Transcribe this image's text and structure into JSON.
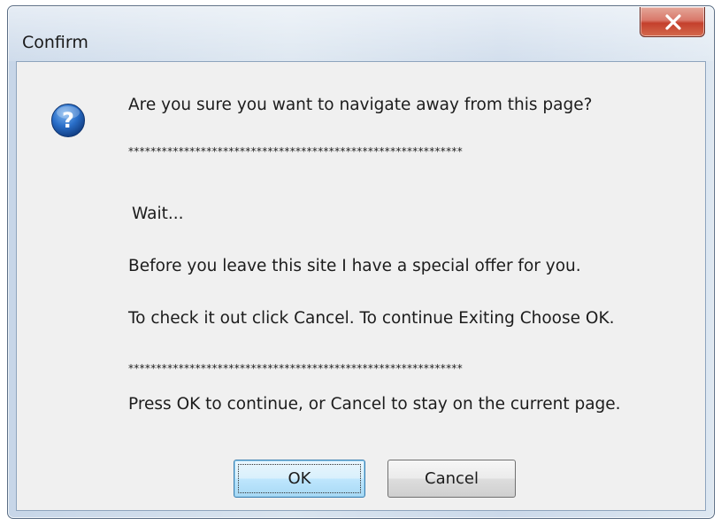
{
  "window": {
    "title": "Confirm"
  },
  "icons": {
    "question": "question-icon",
    "close": "close-icon"
  },
  "message": {
    "line1": "Are you sure you want to navigate away from this page?",
    "stars1": "************************************************************",
    "line2": "Wait...",
    "line3": "Before you leave this site I have a special offer for you.",
    "line4": "To check it out click Cancel. To continue Exiting Choose OK.",
    "stars2": "************************************************************",
    "line5": "Press OK to continue, or Cancel to stay on the current page."
  },
  "buttons": {
    "ok_label": "OK",
    "cancel_label": "Cancel"
  },
  "colors": {
    "close_button": "#c4402c",
    "icon_blue": "#1f5fb4",
    "client_bg": "#f0f0f0"
  }
}
